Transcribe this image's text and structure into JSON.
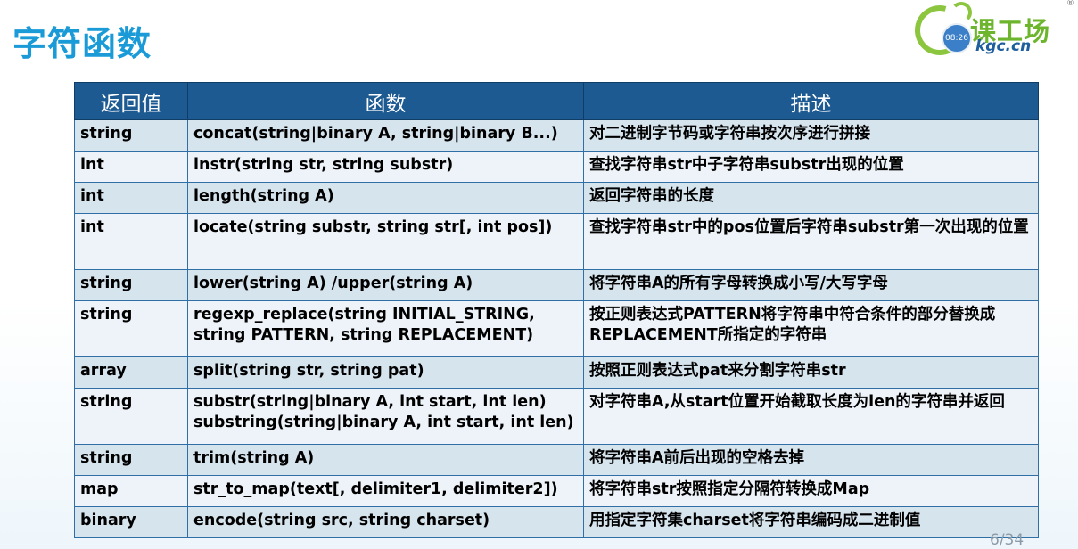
{
  "slide": {
    "title": "字符函数",
    "page": "6/34"
  },
  "logo": {
    "clock": "08:26",
    "cn": "课工场",
    "en": "kgc.cn",
    "reg": "®"
  },
  "table": {
    "headers": [
      "返回值",
      "函数",
      "描述"
    ],
    "rows": [
      {
        "ret": "string",
        "fn": "concat(string|binary A, string|binary B...)",
        "desc": "对二进制字节码或字符串按次序进行拼接"
      },
      {
        "ret": "int",
        "fn": "instr(string str, string substr)",
        "desc": "查找字符串str中子字符串substr出现的位置"
      },
      {
        "ret": "int",
        "fn": "length(string A)",
        "desc": "返回字符串的长度"
      },
      {
        "ret": "int",
        "fn": "locate(string substr, string str[, int pos])",
        "desc": "查找字符串str中的pos位置后字符串substr第一次出现的位置"
      },
      {
        "ret": "string",
        "fn": "lower(string A) /upper(string A)",
        "desc": "将字符串A的所有字母转换成小写/大写字母"
      },
      {
        "ret": "string",
        "fn": "regexp_replace(string INITIAL_STRING, string PATTERN, string REPLACEMENT)",
        "desc": "按正则表达式PATTERN将字符串中符合条件的部分替换成REPLACEMENT所指定的字符串"
      },
      {
        "ret": "array",
        "fn": "split(string str, string pat)",
        "desc": "按照正则表达式pat来分割字符串str"
      },
      {
        "ret": "string",
        "fn": "substr(string|binary A, int start, int len) substring(string|binary A, int start, int len)",
        "desc": "对字符串A,从start位置开始截取长度为len的字符串并返回"
      },
      {
        "ret": "string",
        "fn": "trim(string A)",
        "desc": "将字符串A前后出现的空格去掉"
      },
      {
        "ret": "map",
        "fn": "str_to_map(text[, delimiter1, delimiter2])",
        "desc": "将字符串str按照指定分隔符转换成Map"
      },
      {
        "ret": "binary",
        "fn": "encode(string src, string charset)",
        "desc": "用指定字符集charset将字符串编码成二进制值"
      }
    ]
  }
}
